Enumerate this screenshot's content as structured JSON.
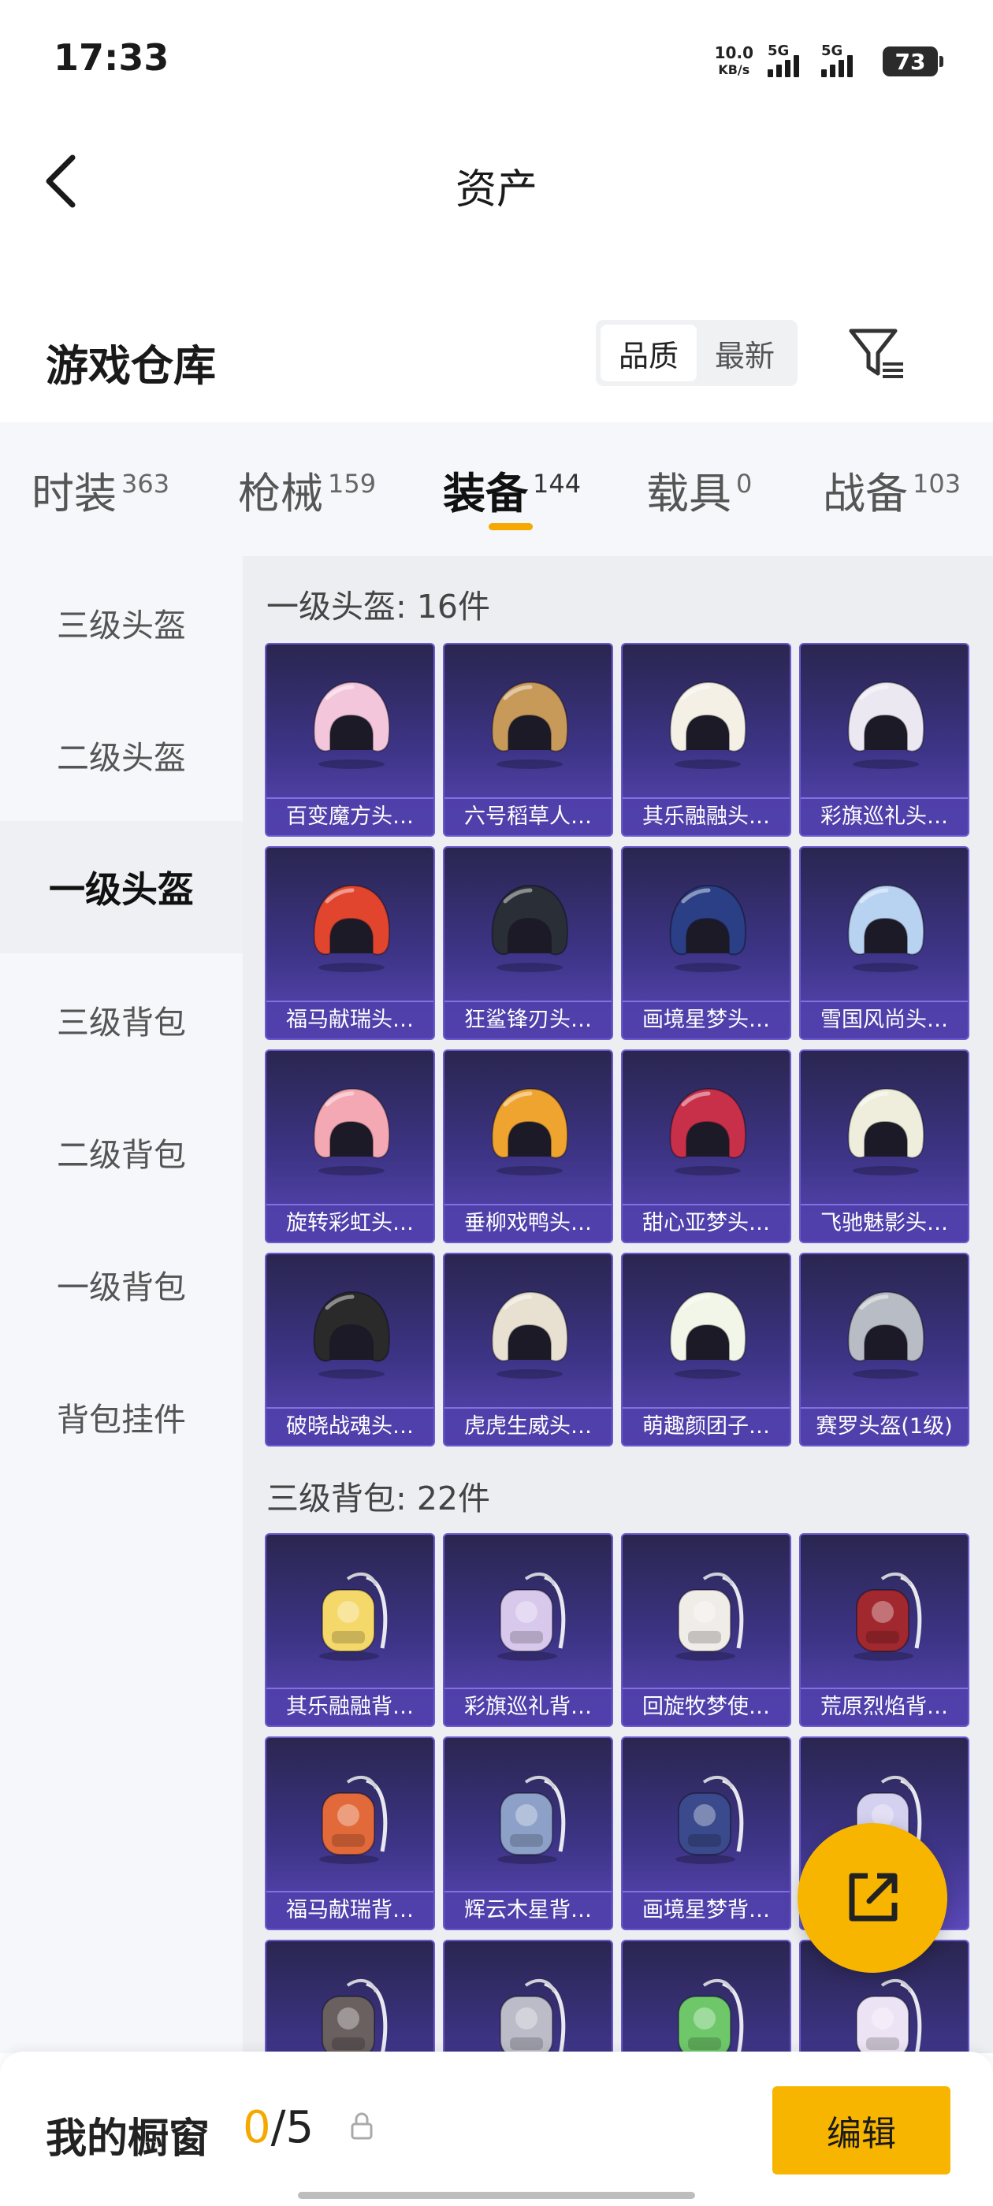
{
  "status": {
    "time": "17:33",
    "net_speed_value": "10.0",
    "net_speed_unit": "KB/s",
    "signal1_label": "5G",
    "signal2_label": "5G",
    "battery": "73"
  },
  "header": {
    "title": "资产"
  },
  "warehouse": {
    "title": "游戏仓库",
    "sort_options": [
      "品质",
      "最新"
    ],
    "sort_selected": "品质"
  },
  "tabs": [
    {
      "label": "时装",
      "count": "363"
    },
    {
      "label": "枪械",
      "count": "159"
    },
    {
      "label": "装备",
      "count": "144",
      "active": true
    },
    {
      "label": "载具",
      "count": "0"
    },
    {
      "label": "战备",
      "count": "103"
    }
  ],
  "sidebar": {
    "items": [
      "三级头盔",
      "二级头盔",
      "一级头盔",
      "三级背包",
      "二级背包",
      "一级背包",
      "背包挂件"
    ],
    "active": "一级头盔"
  },
  "sections": [
    {
      "title": "一级头盔: 16件",
      "items": [
        {
          "name": "百变魔方头…",
          "color": "#f4c6dc",
          "kind": "helmet"
        },
        {
          "name": "六号稻草人…",
          "color": "#c89a5a",
          "kind": "helmet"
        },
        {
          "name": "其乐融融头…",
          "color": "#f4f0e6",
          "kind": "helmet"
        },
        {
          "name": "彩旗巡礼头…",
          "color": "#ece8f2",
          "kind": "helmet"
        },
        {
          "name": "福马献瑞头…",
          "color": "#e2452e",
          "kind": "helmet"
        },
        {
          "name": "狂鲨锋刃头…",
          "color": "#2a2e36",
          "kind": "helmet"
        },
        {
          "name": "画境星梦头…",
          "color": "#2a3f86",
          "kind": "helmet"
        },
        {
          "name": "雪国风尚头…",
          "color": "#b8d2f2",
          "kind": "helmet"
        },
        {
          "name": "旋转彩虹头…",
          "color": "#f4a8b4",
          "kind": "helmet"
        },
        {
          "name": "垂柳戏鸭头…",
          "color": "#f0a430",
          "kind": "helmet"
        },
        {
          "name": "甜心亚梦头…",
          "color": "#c8304a",
          "kind": "helmet"
        },
        {
          "name": "飞驰魅影头…",
          "color": "#efeedd",
          "kind": "helmet"
        },
        {
          "name": "破晓战魂头…",
          "color": "#2a2a2a",
          "kind": "helmet"
        },
        {
          "name": "虎虎生威头…",
          "color": "#e8e0d0",
          "kind": "helmet"
        },
        {
          "name": "萌趣颜团子…",
          "color": "#f2f6e8",
          "kind": "helmet"
        },
        {
          "name": "赛罗头盔(1级)",
          "color": "#b8bcc4",
          "kind": "helmet"
        }
      ]
    },
    {
      "title": "三级背包: 22件",
      "items": [
        {
          "name": "其乐融融背…",
          "color": "#f4d86a",
          "kind": "backpack"
        },
        {
          "name": "彩旗巡礼背…",
          "color": "#d8c8ec",
          "kind": "backpack"
        },
        {
          "name": "回旋牧梦使…",
          "color": "#f0ece8",
          "kind": "backpack"
        },
        {
          "name": "荒原烈焰背…",
          "color": "#a0282e",
          "kind": "backpack"
        },
        {
          "name": "福马献瑞背…",
          "color": "#e26a3a",
          "kind": "backpack"
        },
        {
          "name": "辉云木星背…",
          "color": "#8ca0c8",
          "kind": "backpack"
        },
        {
          "name": "画境星梦背…",
          "color": "#3a4a8c",
          "kind": "backpack"
        },
        {
          "name": "",
          "color": "#d4d0f0",
          "kind": "backpack"
        },
        {
          "name": "",
          "color": "#6a6060",
          "kind": "backpack"
        },
        {
          "name": "",
          "color": "#bcbcc8",
          "kind": "backpack"
        },
        {
          "name": "",
          "color": "#6ec86a",
          "kind": "backpack"
        },
        {
          "name": "",
          "color": "#ece4f4",
          "kind": "backpack"
        }
      ]
    }
  ],
  "showcase": {
    "label": "我的橱窗",
    "count": "0",
    "total": "/5",
    "edit_label": "编辑"
  },
  "colors": {
    "accent": "#f7b500",
    "card_top": "#2a2650",
    "card_bottom": "#5a48b8"
  }
}
